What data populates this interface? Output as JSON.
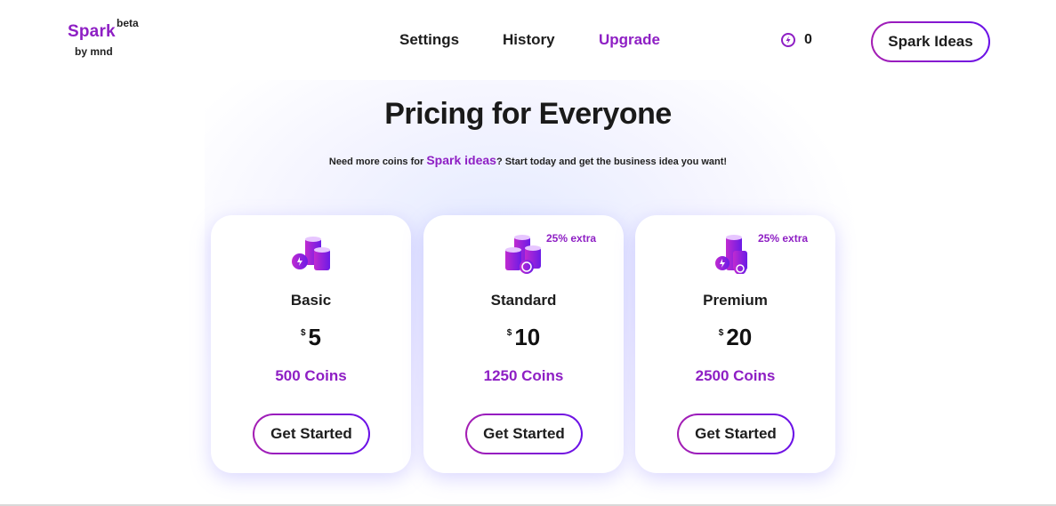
{
  "header": {
    "logo": {
      "brand": "Spark",
      "beta": "beta",
      "by": "by mnd"
    },
    "nav": {
      "settings": "Settings",
      "history": "History",
      "upgrade": "Upgrade"
    },
    "coin_balance": "0",
    "cta_label": "Spark Ideas"
  },
  "hero": {
    "title": "Pricing for Everyone",
    "subtitle_pre": "Need more coins for ",
    "subtitle_accent": "Spark ideas",
    "subtitle_post": "? Start today and get the business idea you want!"
  },
  "plans": [
    {
      "name": "Basic",
      "currency": "$",
      "price": "5",
      "coins": "500 Coins",
      "extra": "",
      "button": "Get Started",
      "icon": "coin-stack-icon"
    },
    {
      "name": "Standard",
      "currency": "$",
      "price": "10",
      "coins": "1250 Coins",
      "extra": "25% extra",
      "button": "Get Started",
      "icon": "coin-stacks-icon"
    },
    {
      "name": "Premium",
      "currency": "$",
      "price": "20",
      "coins": "2500 Coins",
      "extra": "25% extra",
      "button": "Get Started",
      "icon": "coin-tower-icon"
    }
  ],
  "colors": {
    "accent": "#8e1fc4",
    "gradient_start": "#a51fb3",
    "gradient_end": "#6a11e8",
    "text": "#1d1d1d"
  }
}
